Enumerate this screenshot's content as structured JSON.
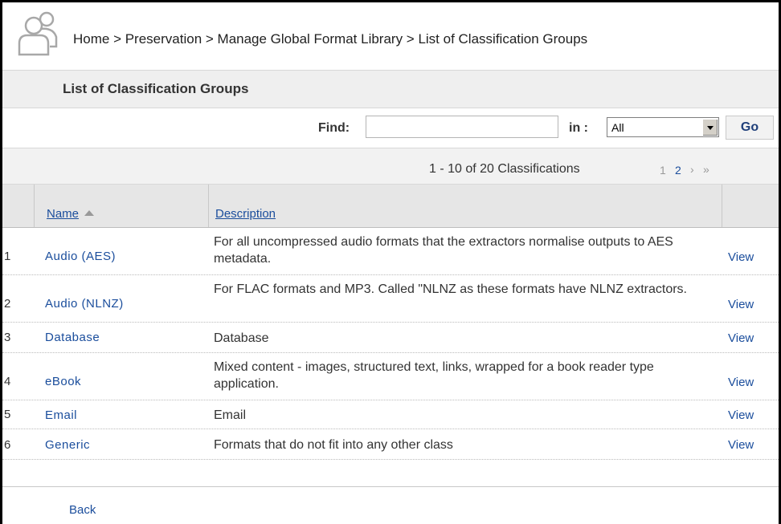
{
  "breadcrumb": "Home > Preservation > Manage Global Format Library > List of Classification Groups",
  "icons": {
    "user": "users-icon",
    "sort": "sort-ascending-icon",
    "dropdown": "chevron-down-icon"
  },
  "title": "List of Classification Groups",
  "find": {
    "label": "Find:",
    "value": "",
    "placeholder": "",
    "in_label": "in :",
    "scope": "All",
    "go_label": "Go"
  },
  "pager": {
    "summary": "1 - 10 of 20 Classifications",
    "page1": "1",
    "page2": "2",
    "next": "›",
    "last": "»"
  },
  "table": {
    "headers": {
      "name": "Name",
      "description": "Description"
    },
    "rows": [
      {
        "num": "1",
        "name": "Audio (AES)",
        "desc": "For all uncompressed audio formats that the extractors normalise outputs to AES metadata.",
        "action": "View"
      },
      {
        "num": "2",
        "name": "Audio (NLNZ)",
        "desc": "For FLAC formats and MP3. Called \"NLNZ as these formats have NLNZ extractors.",
        "action": "View"
      },
      {
        "num": "3",
        "name": "Database",
        "desc": "Database",
        "action": "View"
      },
      {
        "num": "4",
        "name": "eBook",
        "desc": "Mixed content - images, structured text, links, wrapped for a book reader type application.",
        "action": "View"
      },
      {
        "num": "5",
        "name": "Email",
        "desc": "Email",
        "action": "View"
      },
      {
        "num": "6",
        "name": "Generic",
        "desc": "Formats that do not fit into any other class",
        "action": "View"
      }
    ]
  },
  "back_label": "Back",
  "colors": {
    "link": "#1a4d9c",
    "header_bg": "#e6e6e6",
    "band_bg": "#efefef"
  }
}
